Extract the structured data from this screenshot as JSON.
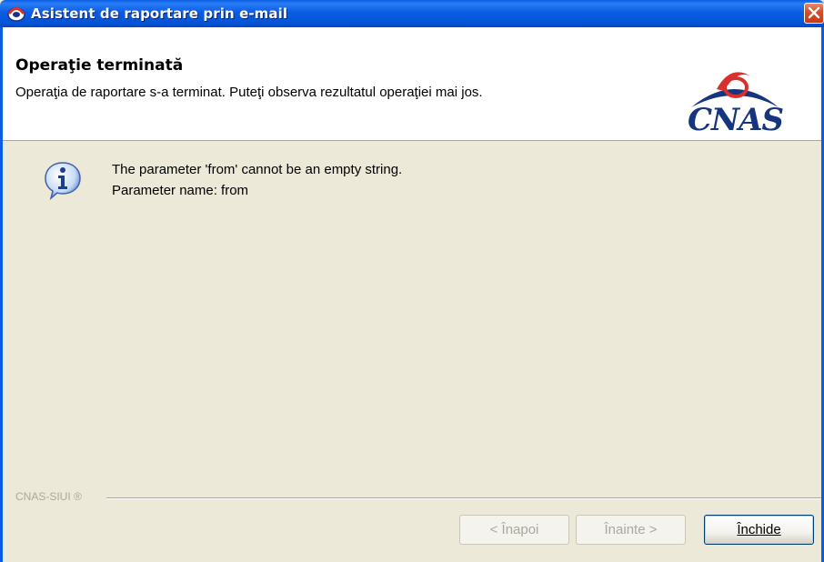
{
  "window": {
    "title": "Asistent de raportare prin e-mail",
    "icon": "cnas-app-icon",
    "close_icon": "close-icon"
  },
  "header": {
    "title": "Operaţie terminată",
    "subtitle": "Operaţia de raportare s-a terminat. Puteţi observa rezultatul operaţiei mai jos.",
    "logo_text": "CNAS"
  },
  "content": {
    "icon": "info-icon",
    "message_line1": "The parameter 'from' cannot be an empty string.",
    "message_line2": "Parameter name: from"
  },
  "footer": {
    "group_label": "CNAS-SIUI ®"
  },
  "buttons": {
    "back": "< Înapoi",
    "next": "Înainte >",
    "close": "Închide"
  },
  "colors": {
    "titlebar": "#0a5de3",
    "dialog_bg": "#ece9d8",
    "logo": "#16357e",
    "logo_accent": "#d8302c"
  }
}
